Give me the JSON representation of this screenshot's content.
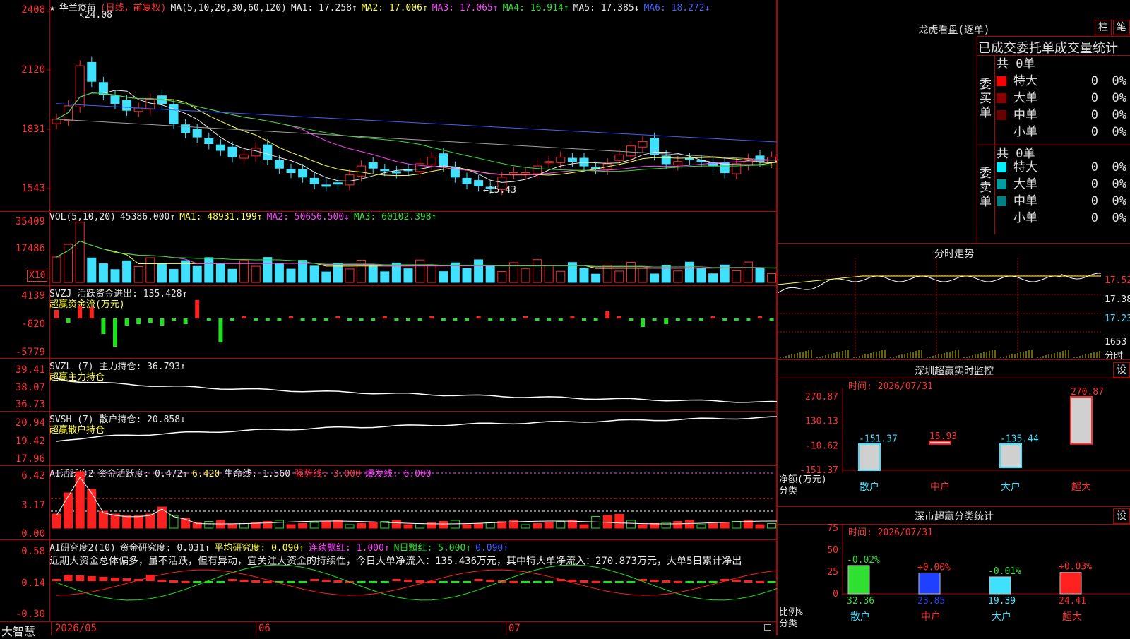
{
  "stock_name": "华兰疫苗",
  "mode_label": "(日线，前复权)",
  "ma_header": {
    "label": "MA(5,10,20,30,60,120)",
    "items": [
      {
        "t": "MA1: 17.258↑",
        "color": "#e8e8e8"
      },
      {
        "t": "MA2: 17.006↑",
        "color": "#ffff40"
      },
      {
        "t": "MA3: 17.065↑",
        "color": "#ff40ff"
      },
      {
        "t": "MA4: 16.914↑",
        "color": "#30e030"
      },
      {
        "t": "MA5: 17.385↓",
        "color": "#e8e8e8"
      },
      {
        "t": "MA6: 18.272↓",
        "color": "#4060ff"
      }
    ]
  },
  "price_axis": [
    "2408",
    "2120",
    "1831",
    "1543"
  ],
  "price_marks": {
    "high": "24.08",
    "low": "←15.43"
  },
  "vol_header": {
    "label": "VOL(5,10,20)",
    "items": [
      {
        "t": "45386.000↑",
        "color": "#e8e8e8"
      },
      {
        "t": "MA1: 48931.199↑",
        "color": "#ffff40"
      },
      {
        "t": "MA2: 50656.500↓",
        "color": "#ff40ff"
      },
      {
        "t": "MA3: 60102.398↑",
        "color": "#30e030"
      }
    ]
  },
  "vol_axis": [
    "35409",
    "17486"
  ],
  "vol_unit": "X10",
  "svzj": {
    "header": "SVZJ  活跃资金进出: 135.428↑",
    "sub": "超赢资金流(万元)",
    "axis": [
      "4139",
      "-820",
      "-5779"
    ]
  },
  "svzl": {
    "header": "SVZL (7) 主力持仓: 36.793↑",
    "sub": "超赢主力持仓",
    "axis": [
      "39.41",
      "38.07",
      "36.73"
    ]
  },
  "svsh": {
    "header": "SVSH (7) 散户持仓: 20.858↓",
    "sub": "超赢散户持仓",
    "axis": [
      "20.94",
      "19.42",
      "17.96"
    ]
  },
  "ai1": {
    "label": "AI活跃度2",
    "items": [
      {
        "t": "资金活跃度: 0.472↑",
        "color": "#e8e8e8"
      },
      {
        "t": "6.420",
        "color": "#ffff40"
      },
      {
        "t": "生命线: 1.560",
        "color": "#e8e8e8"
      },
      {
        "t": "强势线: 3.000",
        "color": "#ff3030"
      },
      {
        "t": "爆发线: 6.000",
        "color": "#ff40ff"
      }
    ],
    "axis": [
      "6.42",
      "3.17",
      "0.00"
    ]
  },
  "ai2": {
    "label": "AI研究度2(10)",
    "items": [
      {
        "t": "资金研究度: 0.031↑",
        "color": "#e8e8e8"
      },
      {
        "t": "平均研究度: 0.090↑",
        "color": "#ffff40"
      },
      {
        "t": "连续飘红: 1.000↑",
        "color": "#ff40ff"
      },
      {
        "t": "N日飘红: 5.000↑",
        "color": "#30e030"
      },
      {
        "t": "0.090↑",
        "color": "#4060ff"
      }
    ],
    "text": "近期大资金总体偏多，虽不活跃，但有异动，宜关注大资金的持续性，今日大单净流入：135.436万元，其中特大单净流入：270.873万元，大单5日累计净出",
    "axis": [
      "0.58",
      "0.14",
      "-0.30"
    ]
  },
  "x_axis": {
    "brand": "大智慧",
    "labels": [
      "2026/05",
      "06",
      "07"
    ]
  },
  "dragon": {
    "title": "龙虎看盘(逐单)",
    "tab1": "柱",
    "tab2": "笔",
    "subtitle": "已成交委托单成交量统计",
    "buy_label": "委买单",
    "sell_label": "委卖单",
    "buy_total": "共 0单",
    "sell_total": "共 0单",
    "buy_rows": [
      {
        "name": "特大",
        "v": "0",
        "p": "0%",
        "color": "#ff0000"
      },
      {
        "name": "大单",
        "v": "0",
        "p": "0%",
        "color": "#8a0000"
      },
      {
        "name": "中单",
        "v": "0",
        "p": "0%",
        "color": "#6a0000"
      },
      {
        "name": "小单",
        "v": "0",
        "p": "0%",
        "color": ""
      }
    ],
    "sell_rows": [
      {
        "name": "特大",
        "v": "0",
        "p": "0%",
        "color": "#00f0ff"
      },
      {
        "name": "大单",
        "v": "0",
        "p": "0%",
        "color": "#00a0a0"
      },
      {
        "name": "中单",
        "v": "0",
        "p": "0%",
        "color": "#008080"
      },
      {
        "name": "小单",
        "v": "0",
        "p": "0%",
        "color": ""
      }
    ]
  },
  "intraday": {
    "title": "分时走势",
    "axis": [
      "17.52",
      "17.38",
      "17.23"
    ],
    "vol": "1653",
    "unit": "分时"
  },
  "sz_monitor": {
    "title": "深圳超赢实时监控",
    "set": "设",
    "time": "时间: 2026/07/31",
    "axis": [
      "270.87",
      "130.13",
      "-10.62",
      "-151.37"
    ],
    "bars": [
      {
        "cat": "散户",
        "v": -151.37,
        "label": "-151.37",
        "catcolor": "#40e0ff"
      },
      {
        "cat": "中户",
        "v": 15.93,
        "label": "15.93",
        "catcolor": "#ff3030"
      },
      {
        "cat": "大户",
        "v": -135.44,
        "label": "-135.44",
        "catcolor": "#40e0ff"
      },
      {
        "cat": "超大",
        "v": 270.87,
        "label": "270.87",
        "catcolor": "#ff3030"
      }
    ],
    "left_label1": "净额(万元)",
    "left_label2": "分类"
  },
  "sz_class": {
    "title": "深市超赢分类统计",
    "set": "设",
    "time": "时间: 2026/07/31",
    "axis": [
      "75",
      "50",
      "25",
      "0"
    ],
    "bars": [
      {
        "cat": "散户",
        "v": 32.36,
        "label": "32.36",
        "top": "-0.02%",
        "color": "#30e030",
        "topcolor": "#30e030"
      },
      {
        "cat": "中户",
        "v": 23.85,
        "label": "23.85",
        "top": "+0.00%",
        "color": "#2040ff",
        "topcolor": "#ff3030"
      },
      {
        "cat": "大户",
        "v": 19.39,
        "label": "19.39",
        "top": "-0.01%",
        "color": "#40e0ff",
        "topcolor": "#30e030"
      },
      {
        "cat": "超大",
        "v": 24.41,
        "label": "24.41",
        "top": "+0.03%",
        "color": "#ff2020",
        "topcolor": "#ff3030"
      }
    ],
    "left_label1": "比例%",
    "left_label2": "分类"
  },
  "chart_data": {
    "type": "candlestick",
    "title": "华兰疫苗 (日线，前复权)",
    "close": [
      19.2,
      19.8,
      21.6,
      20.9,
      20.3,
      19.9,
      19.6,
      19.7,
      20.1,
      19.9,
      19.0,
      18.6,
      18.4,
      18.1,
      17.8,
      17.5,
      17.6,
      17.9,
      17.4,
      17.0,
      16.8,
      16.6,
      16.3,
      16.2,
      16.3,
      16.7,
      17.1,
      17.0,
      16.9,
      16.8,
      16.9,
      17.2,
      17.5,
      17.1,
      16.6,
      16.3,
      16.2,
      16.1,
      16.6,
      16.8,
      16.8,
      17.1,
      17.3,
      17.5,
      17.3,
      17.1,
      17.0,
      17.2,
      17.6,
      18.0,
      18.2,
      17.6,
      17.2,
      17.3,
      17.4,
      17.3,
      17.1,
      16.8,
      17.2,
      17.4,
      17.3,
      17.5,
      17.6
    ]
  }
}
